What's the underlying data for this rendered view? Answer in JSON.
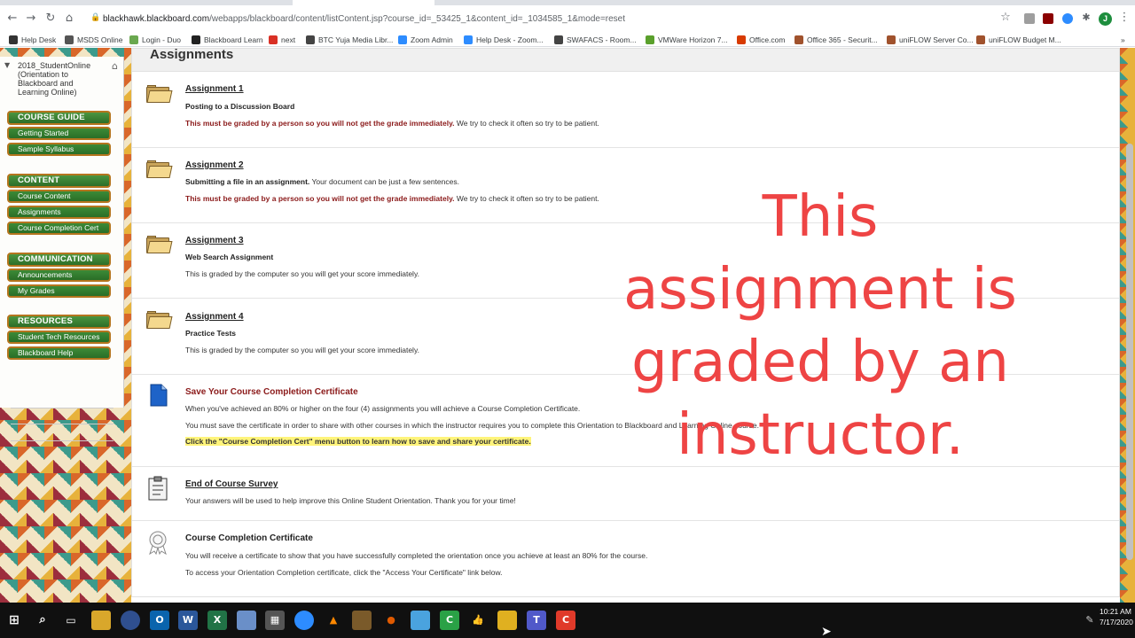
{
  "browser": {
    "url_host": "blackhawk.blackboard.com",
    "url_path": "/webapps/blackboard/content/listContent.jsp?course_id=_53425_1&content_id=_1034585_1&mode=reset",
    "profile_initial": "J",
    "back_icon": "arrow-left-icon",
    "forward_icon": "arrow-right-icon",
    "reload_icon": "reload-icon",
    "home_icon": "home-icon",
    "bookmarks": [
      {
        "label": "Help Desk",
        "color": "#333333"
      },
      {
        "label": "MSDS Online",
        "color": "#555555"
      },
      {
        "label": "Login - Duo",
        "color": "#6aa84f"
      },
      {
        "label": "Blackboard Learn",
        "color": "#222222"
      },
      {
        "label": "next",
        "color": "#d93025"
      },
      {
        "label": "BTC Yuja Media Libr...",
        "color": "#444444"
      },
      {
        "label": "Zoom Admin",
        "color": "#2d8cff"
      },
      {
        "label": "Help Desk - Zoom...",
        "color": "#2d8cff"
      },
      {
        "label": "SWAFACS - Room...",
        "color": "#444444"
      },
      {
        "label": "VMWare Horizon 7...",
        "color": "#5aa02c"
      },
      {
        "label": "Office.com",
        "color": "#d83b01"
      },
      {
        "label": "Office 365 - Securit...",
        "color": "#a0522d"
      },
      {
        "label": "uniFLOW Server Co...",
        "color": "#a0522d"
      },
      {
        "label": "uniFLOW Budget M...",
        "color": "#a0522d"
      }
    ]
  },
  "sidebar": {
    "course_title": "2018_StudentOnline (Orientation to Blackboard and Learning Online)",
    "groups": [
      {
        "heading": "COURSE GUIDE",
        "items": [
          "Getting Started",
          "Sample Syllabus"
        ]
      },
      {
        "heading": "CONTENT",
        "items": [
          "Course Content",
          "Assignments",
          "Course Completion Cert"
        ]
      },
      {
        "heading": "COMMUNICATION",
        "items": [
          "Announcements",
          "My Grades"
        ]
      },
      {
        "heading": "RESOURCES",
        "items": [
          "Student Tech Resources",
          "Blackboard Help"
        ]
      }
    ]
  },
  "main": {
    "title": "Assignments",
    "items": [
      {
        "title": "Assignment 1",
        "subtitle": "Posting to a Discussion Board",
        "warn_bold": "This must be graded by a person so you will not get the grade immediately.",
        "warn_rest": " We try to check it often so try to be patient."
      },
      {
        "title": "Assignment 2",
        "sub_bold": "Submitting a file in an assignment.",
        "sub_rest": " Your document can be just a few sentences.",
        "warn_bold": "This must be graded by a person so you will not get the grade immediately.",
        "warn_rest": " We try to check it often so try to be patient."
      },
      {
        "title": "Assignment 3",
        "subtitle": "Web Search Assignment",
        "note": "This is graded by the computer so you will get your score immediately."
      },
      {
        "title": "Assignment 4",
        "subtitle": "Practice Tests",
        "note": "This is graded by the computer so you will get your score immediately."
      },
      {
        "title": "Save Your Course Completion Certificate",
        "line1": "When you've achieved an 80% or higher on the four (4) assignments you will achieve a Course Completion Certificate.",
        "line2": "You must save the certificate in order to share with other courses in which the instructor requires you to complete this Orientation to Blackboard and Learning Online course.",
        "highlight": "Click the \"Course Completion Cert\" menu button to learn how to save and share your certificate."
      },
      {
        "title": "End of Course Survey",
        "line1": "Your answers will be used to help improve this Online Student Orientation. Thank you for your time!"
      },
      {
        "title": "Course Completion Certificate",
        "line1": "You will receive a certificate to show that you have successfully completed the orientation once you achieve at least an 80% for the course.",
        "line2": "To access your Orientation Completion certificate, click the \"Access Your Certificate\" link below."
      }
    ]
  },
  "overlay": {
    "text_1": "This",
    "text_2": "assignment is",
    "text_3": "graded by an",
    "text_4": "instructor.",
    "color": "#ee4444"
  },
  "taskbar": {
    "time": "10:21 AM",
    "date": "7/17/2020"
  }
}
